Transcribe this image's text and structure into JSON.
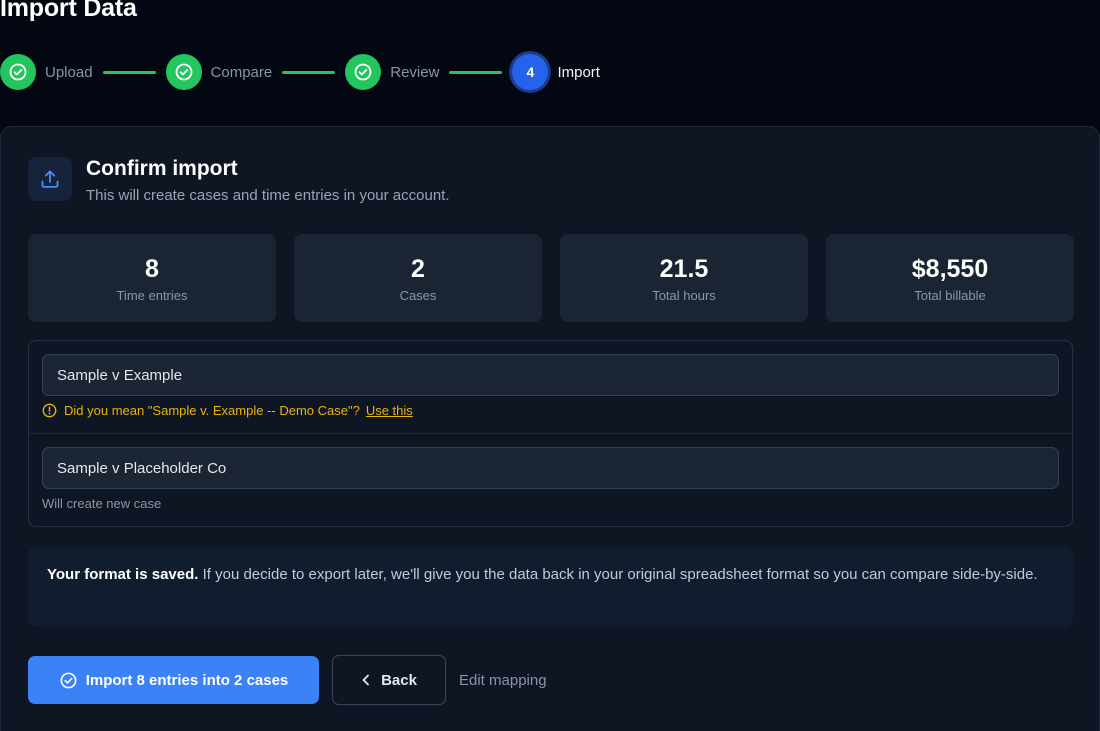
{
  "page": {
    "title": "Import Data"
  },
  "stepper": {
    "steps": [
      {
        "label": "Upload",
        "status": "done",
        "icon": "check-circle-icon"
      },
      {
        "label": "Compare",
        "status": "done",
        "icon": "check-circle-icon"
      },
      {
        "label": "Review",
        "status": "done",
        "icon": "check-circle-icon"
      },
      {
        "label": "Import",
        "status": "current",
        "number": "4"
      }
    ]
  },
  "confirm": {
    "icon": "upload-icon",
    "title": "Confirm import",
    "subtitle": "This will create cases and time entries in your account."
  },
  "stats": [
    {
      "value": "8",
      "label": "Time entries"
    },
    {
      "value": "2",
      "label": "Cases"
    },
    {
      "value": "21.5",
      "label": "Total hours"
    },
    {
      "value": "$8,550",
      "label": "Total billable"
    }
  ],
  "cases": {
    "first_value": "Sample v Example",
    "suggestion_text": "Did you mean \"Sample v. Example -- Demo Case\"?",
    "suggestion_link": "Use this",
    "second_value": "Sample v Placeholder Co",
    "second_note": "Will create new case"
  },
  "info": {
    "bold": "Your format is saved.",
    "text": " If you decide to export later, we'll give you the data back in your original spreadsheet format so you can compare side-by-side."
  },
  "actions": {
    "import_label": "Import 8 entries into 2 cases",
    "back_label": "Back",
    "edit_label": "Edit mapping"
  },
  "colors": {
    "background": "#020712",
    "card": "#0f1623",
    "success": "#22c55e",
    "accent": "#3b82f6",
    "warning": "#eab308"
  }
}
